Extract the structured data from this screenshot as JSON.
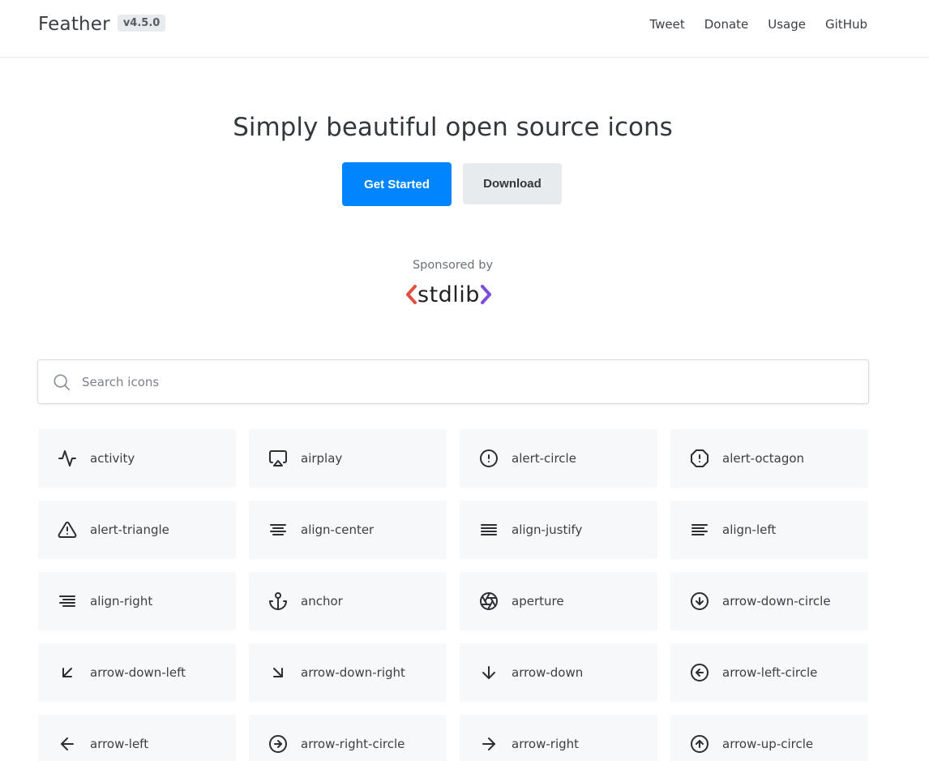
{
  "header": {
    "brand": "Feather",
    "version": "v4.5.0",
    "nav": [
      "Tweet",
      "Donate",
      "Usage",
      "GitHub"
    ]
  },
  "hero": {
    "title": "Simply beautiful open source icons",
    "primary_button": "Get Started",
    "secondary_button": "Download",
    "accent_color": "#0085ff"
  },
  "sponsor": {
    "label": "Sponsored by",
    "logo_text": "stdlib"
  },
  "search": {
    "placeholder": "Search icons",
    "value": ""
  },
  "icons": [
    {
      "name": "activity",
      "icon": "activity-icon"
    },
    {
      "name": "airplay",
      "icon": "airplay-icon"
    },
    {
      "name": "alert-circle",
      "icon": "alert-circle-icon"
    },
    {
      "name": "alert-octagon",
      "icon": "alert-octagon-icon"
    },
    {
      "name": "alert-triangle",
      "icon": "alert-triangle-icon"
    },
    {
      "name": "align-center",
      "icon": "align-center-icon"
    },
    {
      "name": "align-justify",
      "icon": "align-justify-icon"
    },
    {
      "name": "align-left",
      "icon": "align-left-icon"
    },
    {
      "name": "align-right",
      "icon": "align-right-icon"
    },
    {
      "name": "anchor",
      "icon": "anchor-icon"
    },
    {
      "name": "aperture",
      "icon": "aperture-icon"
    },
    {
      "name": "arrow-down-circle",
      "icon": "arrow-down-circle-icon"
    },
    {
      "name": "arrow-down-left",
      "icon": "arrow-down-left-icon"
    },
    {
      "name": "arrow-down-right",
      "icon": "arrow-down-right-icon"
    },
    {
      "name": "arrow-down",
      "icon": "arrow-down-icon"
    },
    {
      "name": "arrow-left-circle",
      "icon": "arrow-left-circle-icon"
    },
    {
      "name": "arrow-left",
      "icon": "arrow-left-icon"
    },
    {
      "name": "arrow-right-circle",
      "icon": "arrow-right-circle-icon"
    },
    {
      "name": "arrow-right",
      "icon": "arrow-right-icon"
    },
    {
      "name": "arrow-up-circle",
      "icon": "arrow-up-circle-icon"
    }
  ]
}
